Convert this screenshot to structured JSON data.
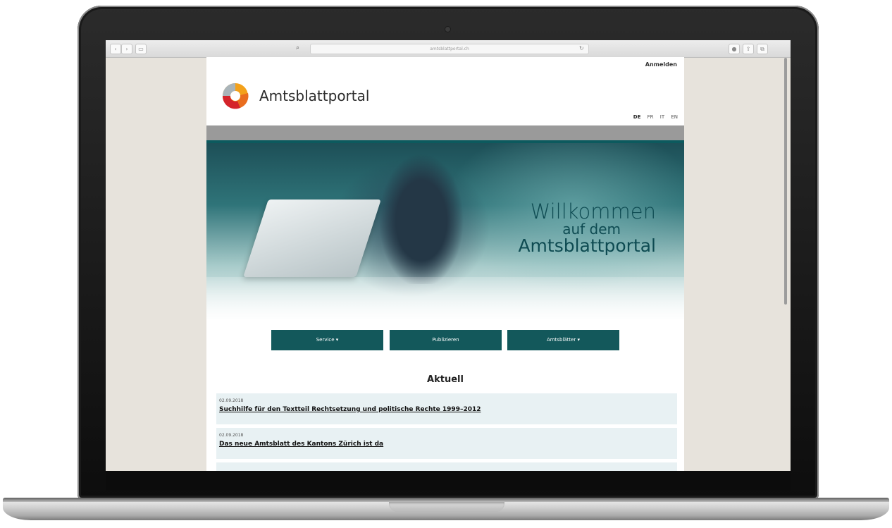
{
  "browser": {
    "url": "amtsblattportal.ch"
  },
  "page": {
    "login_label": "Anmelden",
    "site_title": "Amtsblattportal",
    "languages": [
      {
        "code": "DE",
        "active": true
      },
      {
        "code": "FR",
        "active": false
      },
      {
        "code": "IT",
        "active": false
      },
      {
        "code": "EN",
        "active": false
      }
    ],
    "hero": {
      "line1": "Willkommen",
      "line2": "auf dem",
      "line3": "Amtsblattportal"
    },
    "nav_buttons": [
      {
        "label": "Service ▾"
      },
      {
        "label": "Publizieren"
      },
      {
        "label": "Amtsblätter ▾"
      }
    ],
    "section_title": "Aktuell",
    "news": [
      {
        "date": "02.09.2018",
        "title": "Suchhilfe für den Textteil Rechtsetzung und politische Rechte 1999–2012"
      },
      {
        "date": "02.09.2018",
        "title": "Das neue Amtsblatt des Kantons Zürich ist da"
      }
    ]
  },
  "colors": {
    "accent": "#13585b",
    "news_background": "#e8f1f3",
    "gray_bar": "#9a9a9a"
  },
  "icons": [
    "back-icon",
    "forward-icon",
    "sidebar-icon",
    "search-icon",
    "reload-icon",
    "share-icon",
    "tabs-icon"
  ]
}
